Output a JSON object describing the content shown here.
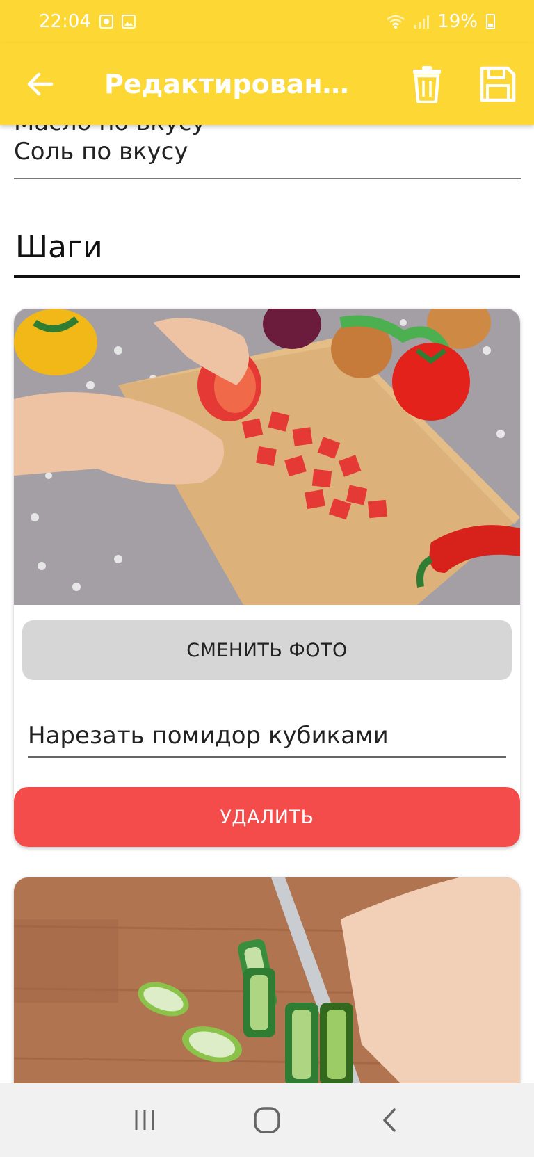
{
  "status_bar": {
    "time": "22:04",
    "battery": "19%",
    "icons": [
      "settings-icon",
      "image-icon",
      "wifi-icon",
      "signal-icon",
      "battery-icon"
    ]
  },
  "app_bar": {
    "title": "Редактирование…",
    "background_color": "#FDD835",
    "actions": [
      "back-arrow-icon",
      "trash-icon",
      "save-icon"
    ]
  },
  "ingredients": {
    "lines": [
      "Масло по вкусу",
      "Соль по вкусу"
    ]
  },
  "steps": {
    "heading": "Шаги",
    "cards": [
      {
        "photo": "tomato-cutting-photo",
        "change_photo_label": "СМЕНИТЬ ФОТО",
        "description": "Нарезать помидор кубиками",
        "delete_label": "УДАЛИТЬ"
      },
      {
        "photo": "cucumber-cutting-photo"
      }
    ]
  },
  "colors": {
    "accent": "#FDD835",
    "delete": "#F44B4B",
    "secondary_button": "#D6D6D6"
  },
  "nav_bar": {
    "buttons": [
      "recent-apps-icon",
      "home-icon",
      "back-icon"
    ]
  }
}
